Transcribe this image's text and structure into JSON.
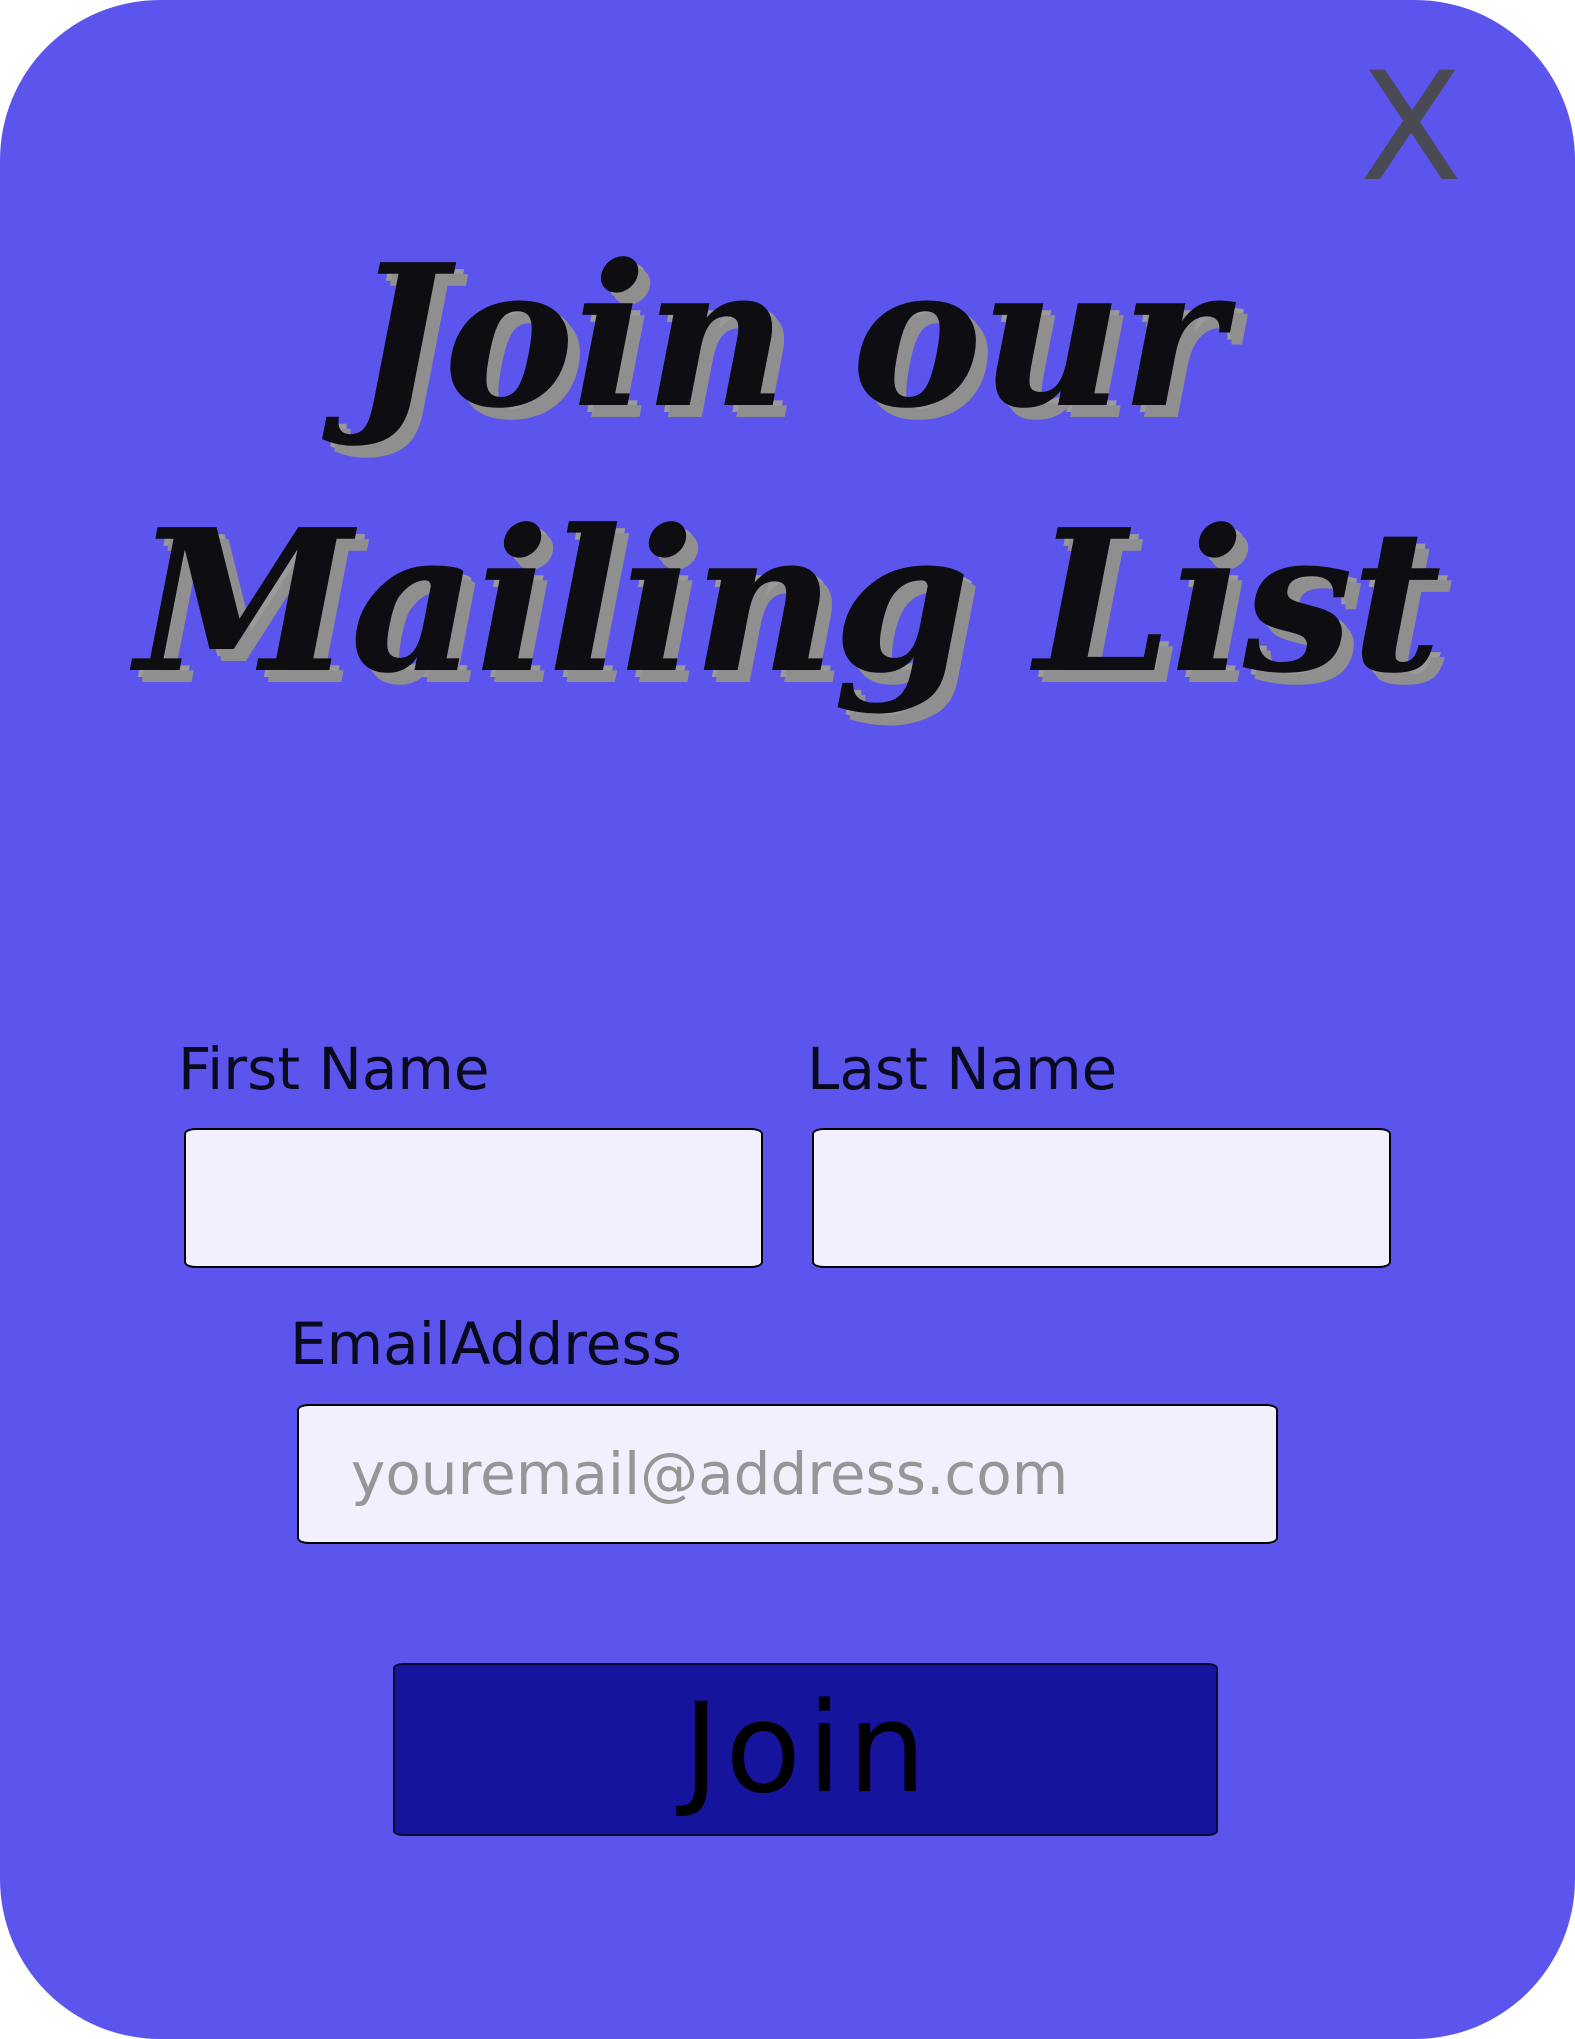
{
  "modal": {
    "close_label": "X",
    "title": "Join our Mailing List"
  },
  "form": {
    "first_name": {
      "label": "First Name",
      "value": "",
      "placeholder": ""
    },
    "last_name": {
      "label": "Last Name",
      "value": "",
      "placeholder": ""
    },
    "email": {
      "label": "EmailAddress",
      "value": "",
      "placeholder": "youremail@address.com"
    },
    "submit_label": "Join"
  },
  "colors": {
    "modal_background": "#5b55ee",
    "input_background": "#f1f0fc",
    "button_background": "#16139c",
    "close_icon": "#4a4a55",
    "title_shadow": "#8f8f8f",
    "placeholder_text": "#969696"
  },
  "icons": {
    "close": "close-icon"
  }
}
